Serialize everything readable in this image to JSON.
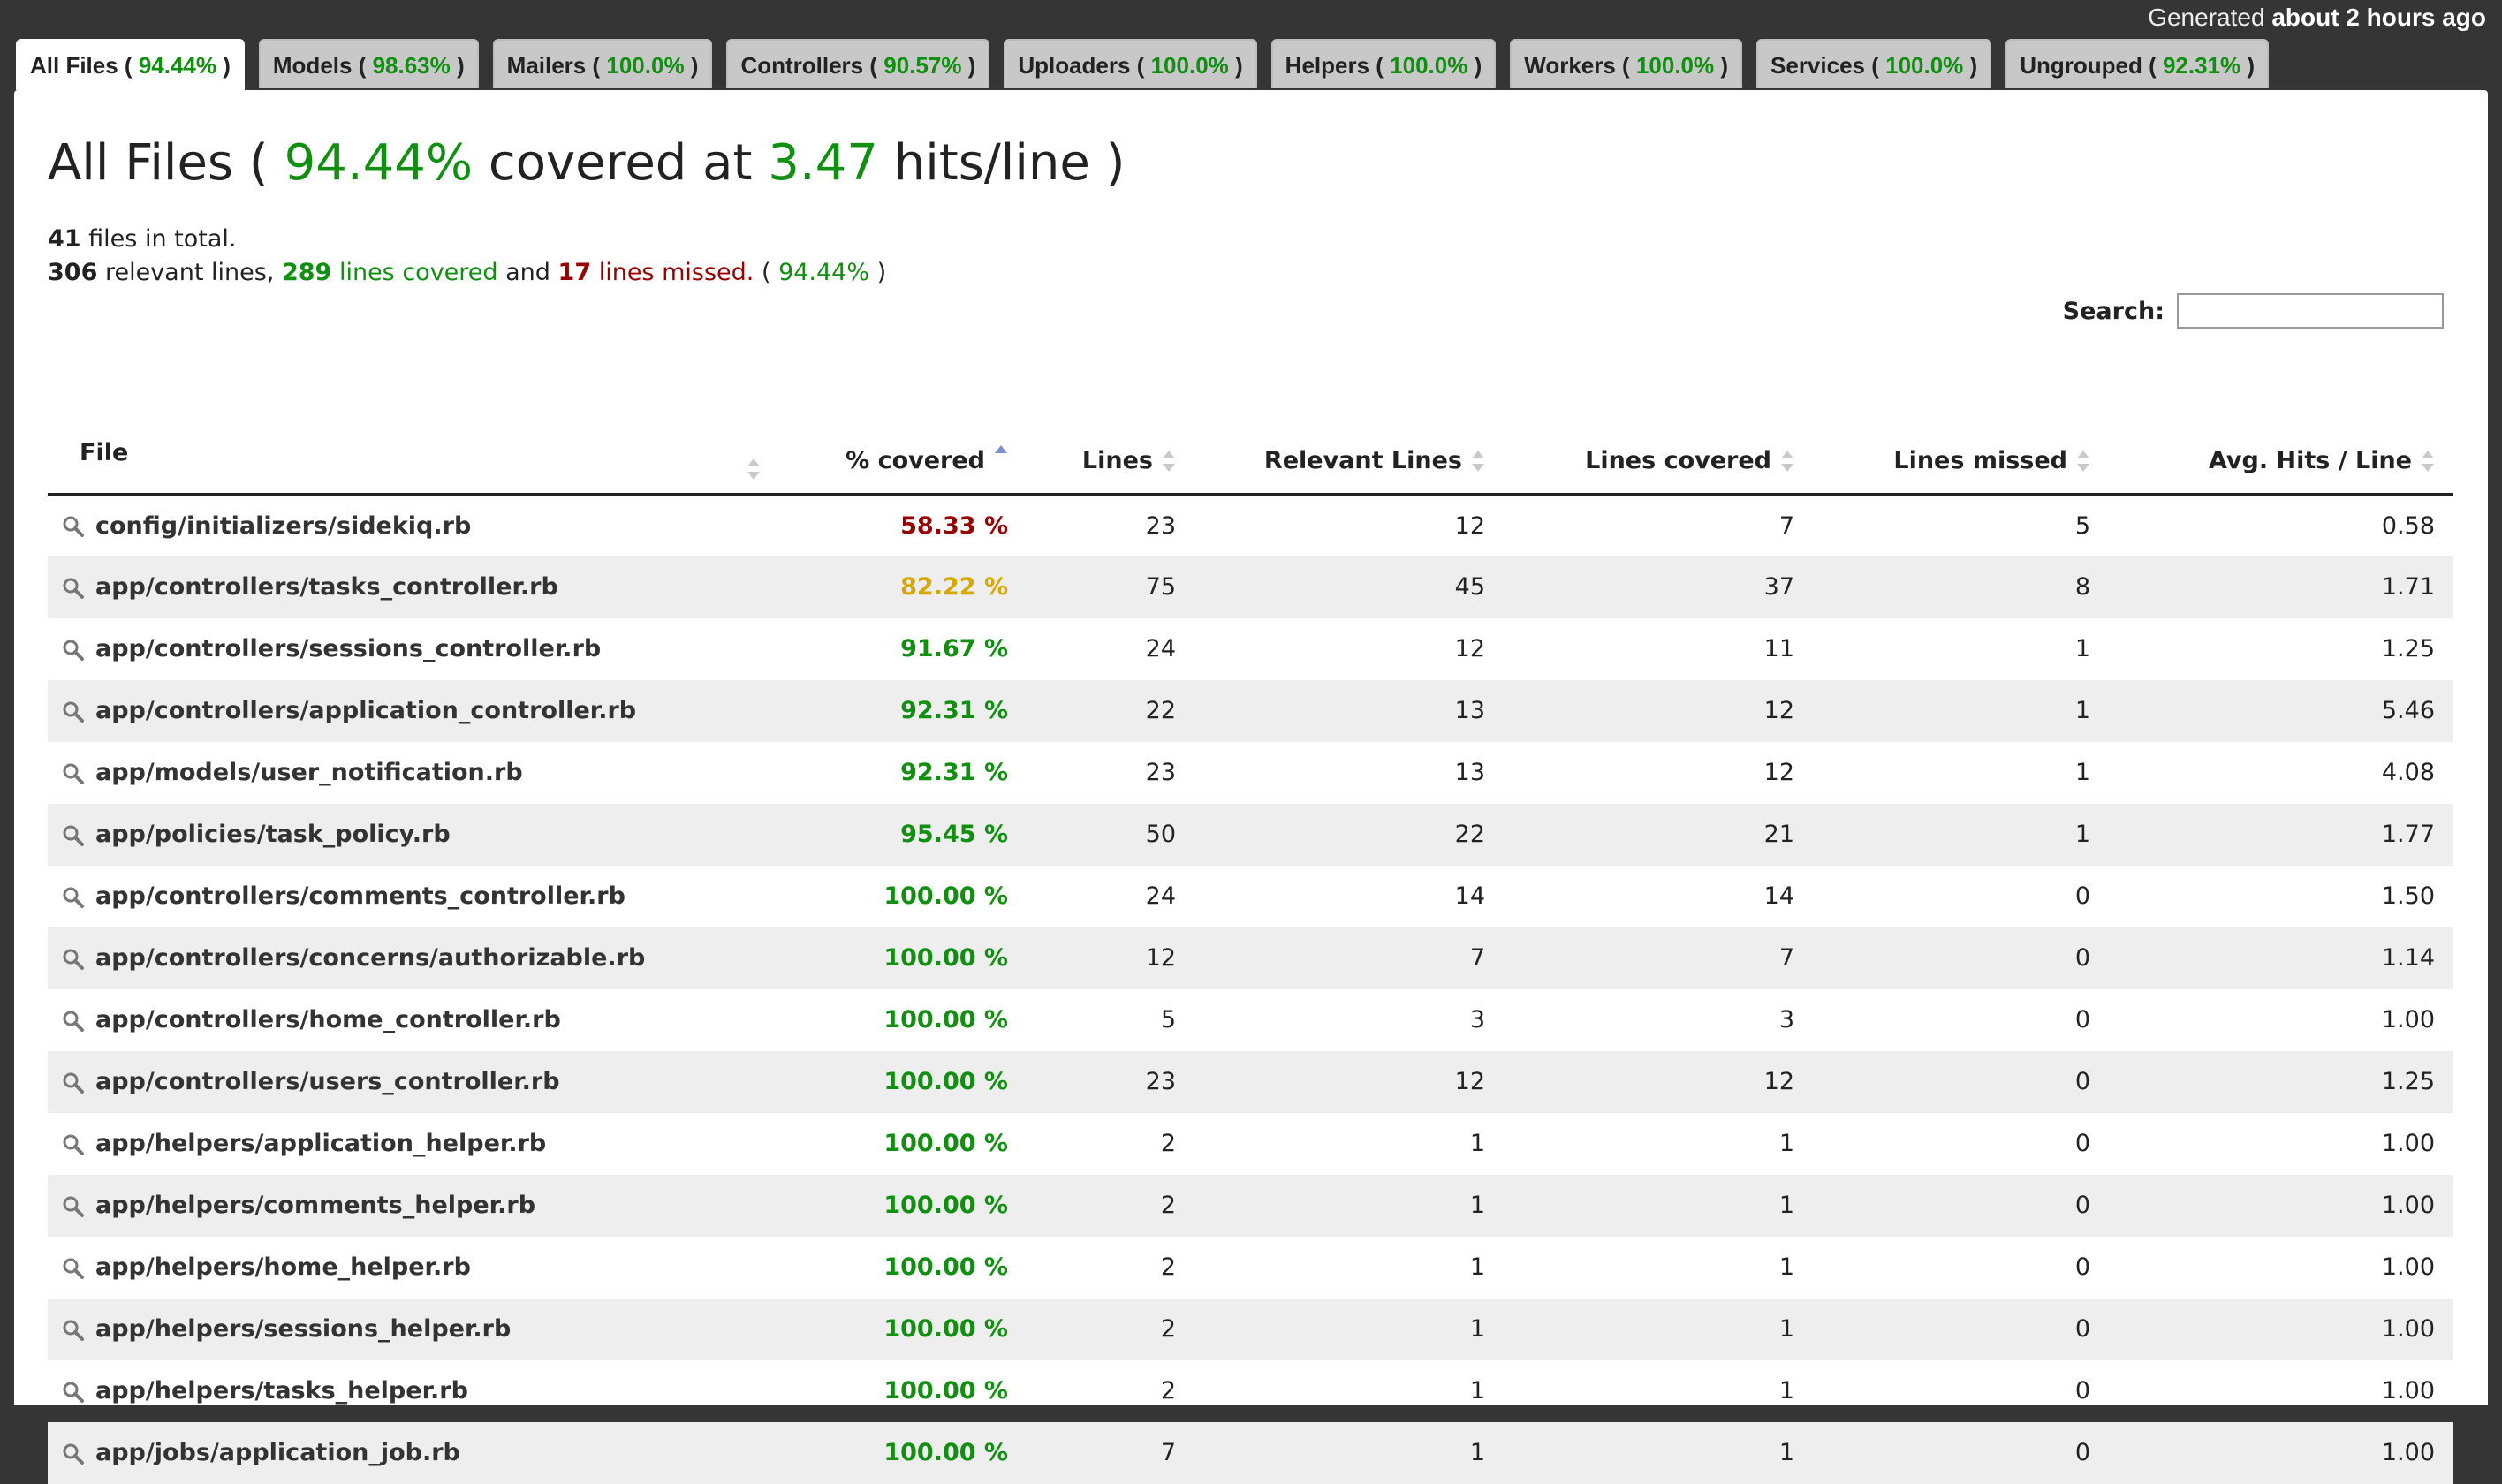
{
  "header": {
    "generated_prefix": "Generated",
    "generated_time": "about 2 hours ago"
  },
  "tabs": [
    {
      "name": "All Files",
      "pct": "94.44%"
    },
    {
      "name": "Models",
      "pct": "98.63%"
    },
    {
      "name": "Mailers",
      "pct": "100.0%"
    },
    {
      "name": "Controllers",
      "pct": "90.57%"
    },
    {
      "name": "Uploaders",
      "pct": "100.0%"
    },
    {
      "name": "Helpers",
      "pct": "100.0%"
    },
    {
      "name": "Workers",
      "pct": "100.0%"
    },
    {
      "name": "Services",
      "pct": "100.0%"
    },
    {
      "name": "Ungrouped",
      "pct": "92.31%"
    }
  ],
  "title": {
    "name": "All Files",
    "pct": "94.44%",
    "covered_at": "covered at",
    "hits": "3.47",
    "hits_label": "hits/line"
  },
  "summary": {
    "files_total": "41",
    "files_label": "files in total.",
    "relevant": "306",
    "relevant_label": "relevant lines,",
    "covered": "289",
    "covered_label": "lines covered",
    "and": "and",
    "missed": "17",
    "missed_label": "lines missed.",
    "pct": "94.44%"
  },
  "search": {
    "label": "Search:",
    "placeholder": ""
  },
  "columns": [
    "File",
    "% covered",
    "Lines",
    "Relevant Lines",
    "Lines covered",
    "Lines missed",
    "Avg. Hits / Line"
  ],
  "colors": {
    "green": "#118f11",
    "red": "#990000",
    "yellow": "#d8a800"
  },
  "rows": [
    {
      "file": "config/initializers/sidekiq.rb",
      "pct": "58.33 %",
      "status": "red",
      "lines": "23",
      "relevant": "12",
      "covered": "7",
      "missed": "5",
      "avg": "0.58"
    },
    {
      "file": "app/controllers/tasks_controller.rb",
      "pct": "82.22 %",
      "status": "yellow",
      "lines": "75",
      "relevant": "45",
      "covered": "37",
      "missed": "8",
      "avg": "1.71"
    },
    {
      "file": "app/controllers/sessions_controller.rb",
      "pct": "91.67 %",
      "status": "green",
      "lines": "24",
      "relevant": "12",
      "covered": "11",
      "missed": "1",
      "avg": "1.25"
    },
    {
      "file": "app/controllers/application_controller.rb",
      "pct": "92.31 %",
      "status": "green",
      "lines": "22",
      "relevant": "13",
      "covered": "12",
      "missed": "1",
      "avg": "5.46"
    },
    {
      "file": "app/models/user_notification.rb",
      "pct": "92.31 %",
      "status": "green",
      "lines": "23",
      "relevant": "13",
      "covered": "12",
      "missed": "1",
      "avg": "4.08"
    },
    {
      "file": "app/policies/task_policy.rb",
      "pct": "95.45 %",
      "status": "green",
      "lines": "50",
      "relevant": "22",
      "covered": "21",
      "missed": "1",
      "avg": "1.77"
    },
    {
      "file": "app/controllers/comments_controller.rb",
      "pct": "100.00 %",
      "status": "green",
      "lines": "24",
      "relevant": "14",
      "covered": "14",
      "missed": "0",
      "avg": "1.50"
    },
    {
      "file": "app/controllers/concerns/authorizable.rb",
      "pct": "100.00 %",
      "status": "green",
      "lines": "12",
      "relevant": "7",
      "covered": "7",
      "missed": "0",
      "avg": "1.14"
    },
    {
      "file": "app/controllers/home_controller.rb",
      "pct": "100.00 %",
      "status": "green",
      "lines": "5",
      "relevant": "3",
      "covered": "3",
      "missed": "0",
      "avg": "1.00"
    },
    {
      "file": "app/controllers/users_controller.rb",
      "pct": "100.00 %",
      "status": "green",
      "lines": "23",
      "relevant": "12",
      "covered": "12",
      "missed": "0",
      "avg": "1.25"
    },
    {
      "file": "app/helpers/application_helper.rb",
      "pct": "100.00 %",
      "status": "green",
      "lines": "2",
      "relevant": "1",
      "covered": "1",
      "missed": "0",
      "avg": "1.00"
    },
    {
      "file": "app/helpers/comments_helper.rb",
      "pct": "100.00 %",
      "status": "green",
      "lines": "2",
      "relevant": "1",
      "covered": "1",
      "missed": "0",
      "avg": "1.00"
    },
    {
      "file": "app/helpers/home_helper.rb",
      "pct": "100.00 %",
      "status": "green",
      "lines": "2",
      "relevant": "1",
      "covered": "1",
      "missed": "0",
      "avg": "1.00"
    },
    {
      "file": "app/helpers/sessions_helper.rb",
      "pct": "100.00 %",
      "status": "green",
      "lines": "2",
      "relevant": "1",
      "covered": "1",
      "missed": "0",
      "avg": "1.00"
    },
    {
      "file": "app/helpers/tasks_helper.rb",
      "pct": "100.00 %",
      "status": "green",
      "lines": "2",
      "relevant": "1",
      "covered": "1",
      "missed": "0",
      "avg": "1.00"
    },
    {
      "file": "app/jobs/application_job.rb",
      "pct": "100.00 %",
      "status": "green",
      "lines": "7",
      "relevant": "1",
      "covered": "1",
      "missed": "0",
      "avg": "1.00"
    }
  ]
}
